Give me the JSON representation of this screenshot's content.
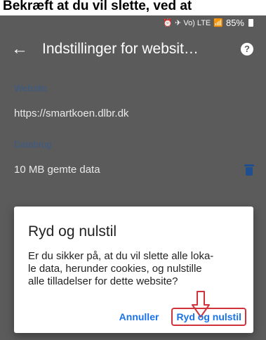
{
  "instruction": "Bekræft at du vil slette, ved at",
  "statusbar": {
    "icons_text": "⏰ ✈ Vo) LTE",
    "signal_text": "📶",
    "battery": "85%"
  },
  "toolbar": {
    "back_icon": "arrow-left",
    "title": "Indstillinger for websit…",
    "help_icon": "?"
  },
  "website": {
    "heading": "Website",
    "url": "https://smartkoen.dlbr.dk"
  },
  "usage": {
    "heading": "Databrug",
    "stored": "10 MB gemte data"
  },
  "dialog": {
    "title": "Ryd og nulstil",
    "body_lines": [
      "Er du sikker på, at du vil slette alle loka-",
      "le data, herunder cookies, og nulstille",
      "alle tilladelser for dette website?"
    ],
    "cancel": "Annuller",
    "confirm": "Ryd og nulstil"
  },
  "colors": {
    "accent": "#1a73e8",
    "highlight": "#d0343a"
  }
}
